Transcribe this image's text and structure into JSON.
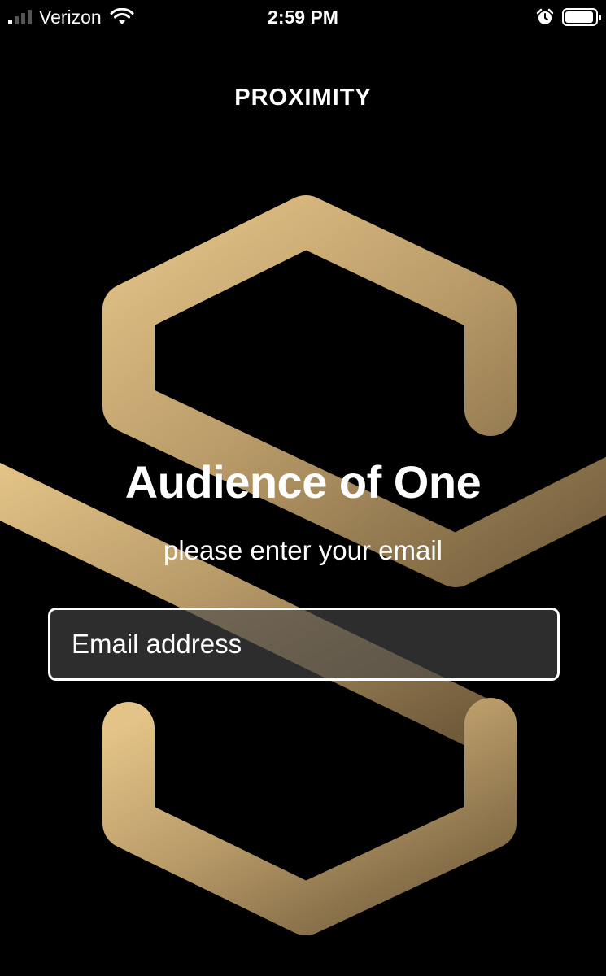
{
  "status_bar": {
    "carrier": "Verizon",
    "time": "2:59 PM",
    "signal_bars_active": 1,
    "signal_bars_total": 4,
    "battery_level": 0.85,
    "icons": [
      "signal-icon",
      "wifi-icon",
      "alarm-icon",
      "battery-icon"
    ]
  },
  "header": {
    "title": "PROXIMITY"
  },
  "main": {
    "heading": "Audience of One",
    "subheading": "please enter your email",
    "email_input": {
      "placeholder": "Email address",
      "value": ""
    }
  },
  "colors": {
    "background": "#000000",
    "logo_gold_light": "#E3C387",
    "logo_gold_dark": "#7A6340",
    "input_fill": "#484848",
    "text": "#FFFFFF"
  }
}
